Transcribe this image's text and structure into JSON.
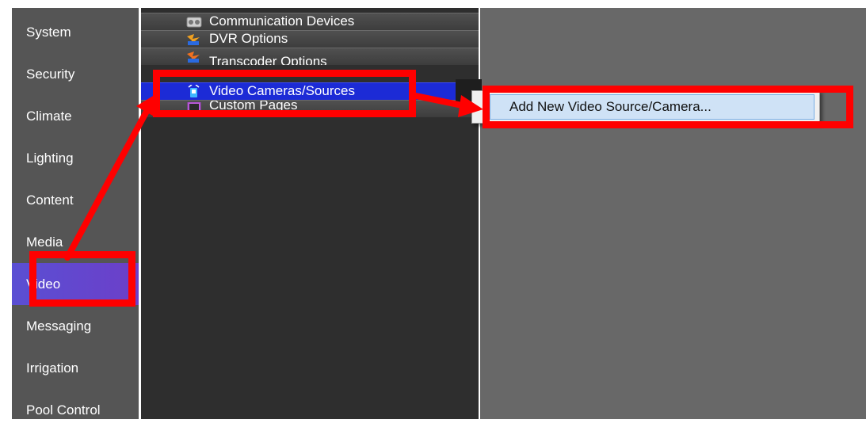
{
  "sidebar": {
    "items": [
      {
        "label": "System"
      },
      {
        "label": "Security"
      },
      {
        "label": "Climate"
      },
      {
        "label": "Lighting"
      },
      {
        "label": "Content"
      },
      {
        "label": "Media"
      },
      {
        "label": "Video"
      },
      {
        "label": "Messaging"
      },
      {
        "label": "Irrigation"
      },
      {
        "label": "Pool Control"
      }
    ],
    "selected": "Video",
    "selected_color": "#5a4fd3"
  },
  "tree": {
    "items": [
      {
        "label": "Communication Devices",
        "icon": "devices-icon"
      },
      {
        "label": "DVR Options",
        "icon": "dvr-icon"
      },
      {
        "label": "Transcoder Options",
        "icon": "transcoder-icon"
      },
      {
        "label": "Video Cameras/Sources",
        "icon": "camera-icon"
      },
      {
        "label": "Custom Pages",
        "icon": "custom-pages-icon"
      }
    ],
    "selected": "Video Cameras/Sources",
    "selected_color": "#1c2bd6"
  },
  "context_menu": {
    "items": [
      {
        "label": "Add New Video Source/Camera..."
      }
    ]
  },
  "annotation": {
    "color": "#ff0000"
  }
}
